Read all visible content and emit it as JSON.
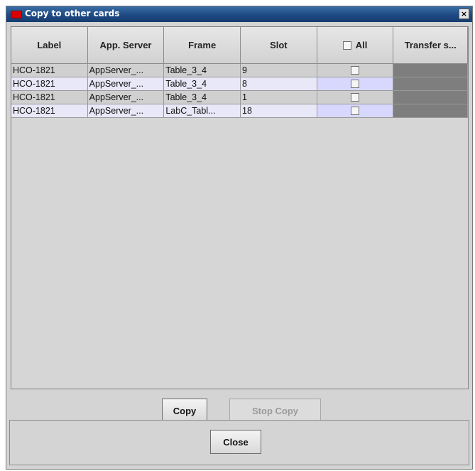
{
  "window": {
    "title": "Copy to other cards",
    "close_glyph": "×"
  },
  "table": {
    "columns": [
      "Label",
      "App. Server",
      "Frame",
      "Slot",
      "All",
      "Transfer s..."
    ],
    "rows": [
      {
        "label": "HCO-1821",
        "app_server": "AppServer_...",
        "frame": "Table_3_4",
        "slot": "9"
      },
      {
        "label": "HCO-1821",
        "app_server": "AppServer_...",
        "frame": "Table_3_4",
        "slot": "8"
      },
      {
        "label": "HCO-1821",
        "app_server": "AppServer_...",
        "frame": "Table_3_4",
        "slot": "1"
      },
      {
        "label": "HCO-1821",
        "app_server": "AppServer_...",
        "frame": "LabC_Tabl...",
        "slot": "18"
      }
    ]
  },
  "buttons": {
    "copy": "Copy",
    "stop_copy": "Stop Copy",
    "close": "Close"
  },
  "icons": {
    "title": "app-window-icon",
    "close": "close-icon"
  },
  "colors": {
    "title_bar": "#1e4a84",
    "title_icon": "#d80000",
    "row_alt": "#e8e8f8",
    "transfer_cell": "#7e7e7e"
  }
}
